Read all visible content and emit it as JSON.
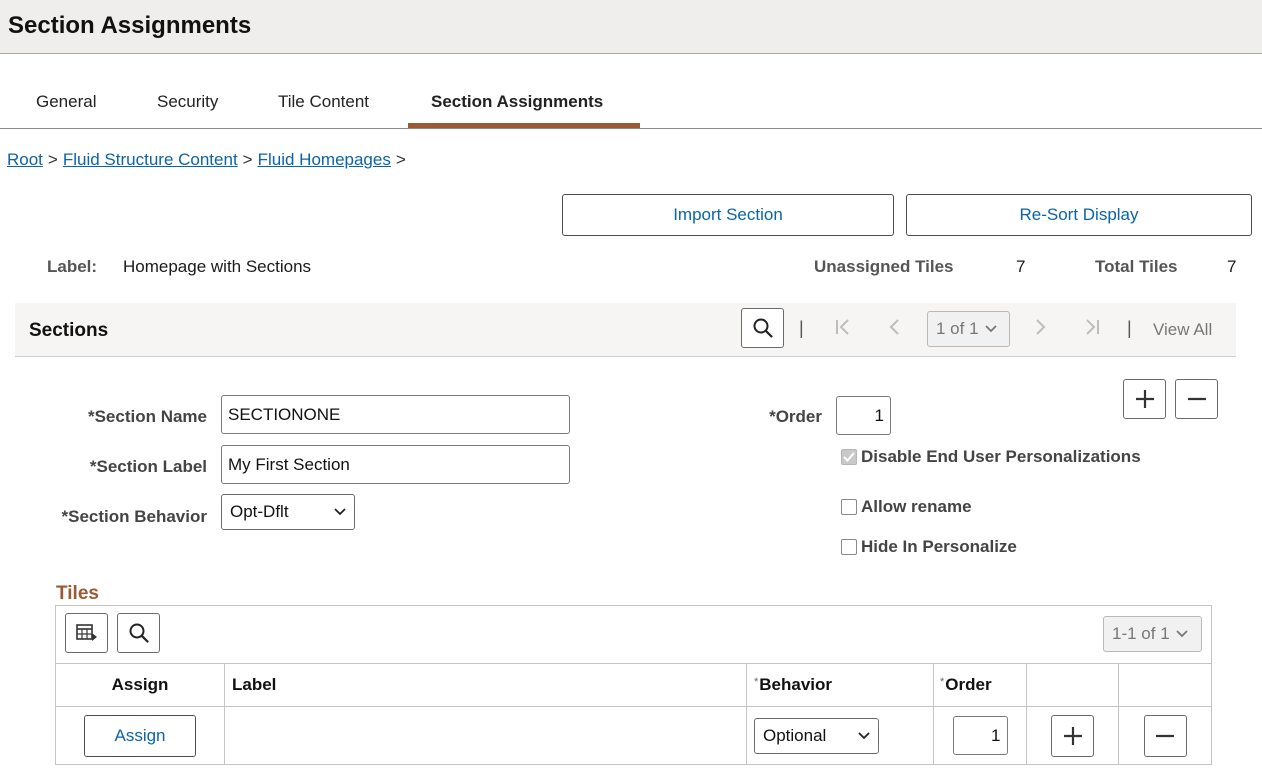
{
  "page": {
    "title": "Section Assignments"
  },
  "tabs": [
    {
      "label": "General"
    },
    {
      "label": "Security"
    },
    {
      "label": "Tile Content"
    },
    {
      "label": "Section Assignments"
    }
  ],
  "breadcrumb": [
    {
      "label": "Root"
    },
    {
      "label": "Fluid Structure Content"
    },
    {
      "label": "Fluid Homepages"
    }
  ],
  "breadcrumb_separator": ">",
  "actions": {
    "import_section": "Import Section",
    "resort_display": "Re-Sort Display"
  },
  "summary": {
    "label_caption": "Label:",
    "label_value": "Homepage with Sections",
    "unassigned_caption": "Unassigned Tiles",
    "unassigned_value": "7",
    "total_caption": "Total Tiles",
    "total_value": "7"
  },
  "sections": {
    "header": "Sections",
    "pager": "1 of 1",
    "separator": "|",
    "view_all": "View All",
    "section_name_label": "*Section Name",
    "section_name_value": "SECTIONONE",
    "section_label_label": "*Section Label",
    "section_label_value": "My First Section",
    "section_behavior_label": "*Section Behavior",
    "section_behavior_value": "Opt-Dflt",
    "order_label": "*Order",
    "order_value": "1",
    "disable_personalizations_label": "Disable End User Personalizations",
    "disable_personalizations_checked": true,
    "allow_rename_label": "Allow rename",
    "allow_rename_checked": false,
    "hide_in_personalize_label": "Hide In Personalize",
    "hide_in_personalize_checked": false
  },
  "tiles": {
    "title": "Tiles",
    "pager": "1-1 of 1",
    "required_marker": "*",
    "columns": {
      "assign": "Assign",
      "label": "Label",
      "behavior": "Behavior",
      "order": "Order"
    },
    "rows": [
      {
        "assign_button": "Assign",
        "label": "",
        "behavior": "Optional",
        "order": "1"
      }
    ]
  },
  "colors": {
    "link": "#0b64a8",
    "accent": "#9b5a34",
    "titlebar": "#efeeec"
  }
}
